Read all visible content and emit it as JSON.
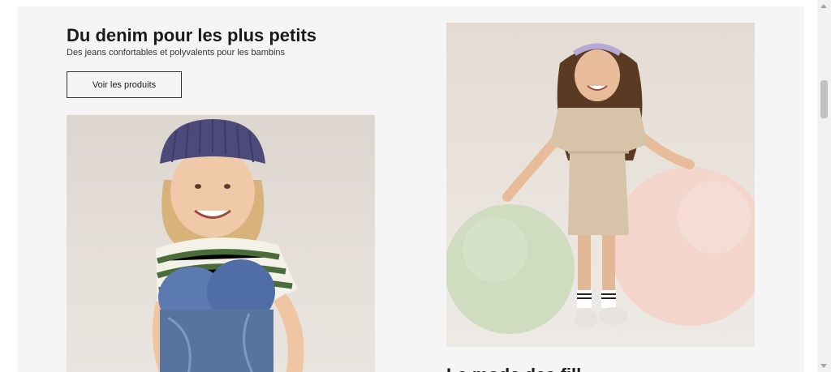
{
  "section": {
    "title": "Du denim pour les plus petits",
    "subtitle": "Des jeans confortables et polyvalents pour les bambins",
    "cta_label": "Voir les produits"
  },
  "next_section": {
    "heading_partial": "La mode des fill"
  },
  "colors": {
    "page_bg": "#f5f5f5",
    "text": "#1a1a1a",
    "button_border": "#333333"
  }
}
